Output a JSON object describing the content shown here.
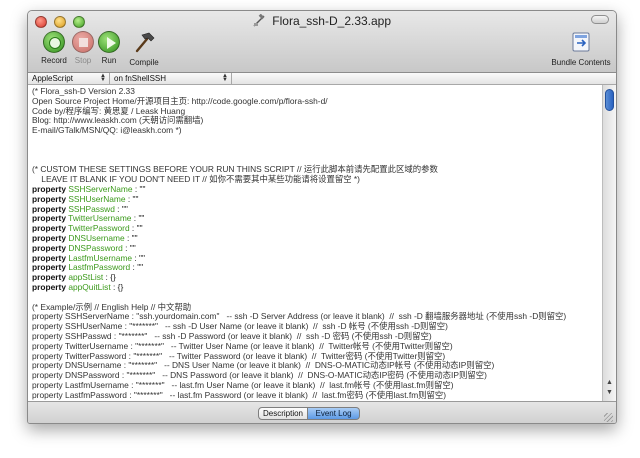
{
  "window": {
    "title": "Flora_ssh-D_2.33.app"
  },
  "toolbar": {
    "record_label": "Record",
    "stop_label": "Stop",
    "run_label": "Run",
    "compile_label": "Compile",
    "bundle_label": "Bundle Contents"
  },
  "selectors": {
    "language": "AppleScript",
    "handler": "on fnShellSSH"
  },
  "editor": {
    "lines": [
      "(* Flora_ssh-D Version 2.33",
      "Open Source Project Home/开源项目主页: http://code.google.com/p/flora-ssh-d/",
      "Code by/程序编写: 黄思夏 / Leask Huang",
      "Blog: http://www.leaskh.com (天朝访问需翻墙)",
      "E-mail/GTalk/MSN/QQ: i@leaskh.com *)",
      "",
      "",
      "(* CUSTOM THESE SETTINGS BEFORE YOUR RUN THINS SCRIPT // 运行此脚本前请先配置此区域的参数",
      "    LEAVE IT BLANK IF YOU DON'T NEED IT // 如你不需要其中某些功能请将设置留空 *)"
    ],
    "properties": [
      {
        "kw": "property",
        "name": "SSHServerName",
        "value": " : \"\""
      },
      {
        "kw": "property",
        "name": "SSHUserName",
        "value": " : \"\""
      },
      {
        "kw": "property",
        "name": "SSHPasswd",
        "value": " : \"\""
      },
      {
        "kw": "property",
        "name": "TwitterUsername",
        "value": " : \"\""
      },
      {
        "kw": "property",
        "name": "TwitterPassword",
        "value": " : \"\""
      },
      {
        "kw": "property",
        "name": "DNSUsername",
        "value": " : \"\""
      },
      {
        "kw": "property",
        "name": "DNSPassword",
        "value": " : \"\""
      },
      {
        "kw": "property",
        "name": "LastfmUsername",
        "value": " : \"\""
      },
      {
        "kw": "property",
        "name": "LastfmPassword",
        "value": " : \"\""
      },
      {
        "kw": "property",
        "name": "appStList",
        "value": " : {}"
      },
      {
        "kw": "property",
        "name": "appQuitList",
        "value": " : {}"
      }
    ],
    "example_lines": [
      "(* Example/示例 // English Help // 中文帮助",
      "property SSHServerName : \"ssh.yourdomain.com\"   -- ssh -D Server Address (or leave it blank)  //  ssh -D 翻墙服务器地址 (不使用ssh -D则留空)",
      "property SSHUserName : \"*******\"   -- ssh -D User Name (or leave it blank)  //  ssh -D 帐号 (不使用ssh -D则留空)",
      "property SSHPasswd : \"*******\"   -- ssh -D Password (or leave it blank)  //  ssh -D 密码 (不使用ssh -D则留空)",
      "property TwitterUsername : \"*******\"   -- Twitter User Name (or leave it blank)  //  Twitter帐号 (不使用Twitter则留空)",
      "property TwitterPassword : \"*******\"   -- Twitter Password (or leave it blank)  //  Twitter密码 (不使用Twitter则留空)",
      "property DNSUsername : \"*******\"   -- DNS User Name (or leave it blank)  //  DNS-O-MATIC动态IP帐号 (不使用动态IP则留空)",
      "property DNSPassword : \"*******\"   -- DNS Password (or leave it blank)  //  DNS-O-MATIC动态IP密码 (不使用动态IP则留空)",
      "property LastfmUsername : \"*******\"   -- last.fm User Name (or leave it blank)  //  last.fm帐号 (不使用last.fm则留空)",
      "property LastfmPassword : \"*******\"   -- last.fm Password (or leave it blank)  //  last.fm密码 (不使用last.fm则留空)"
    ]
  },
  "bottom_tabs": {
    "description": "Description",
    "event_log": "Event Log"
  },
  "colors": {
    "property_name": "#3c9a1c",
    "selected_tab": "#5d9ae6"
  }
}
